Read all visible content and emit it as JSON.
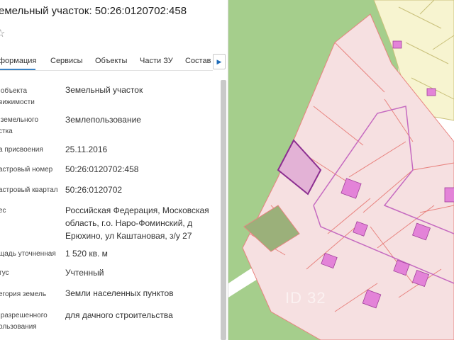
{
  "title": "емельный участок: 50:26:0120702:458",
  "tabs": [
    {
      "label": "формация"
    },
    {
      "label": "Сервисы"
    },
    {
      "label": "Объекты"
    },
    {
      "label": "Части ЗУ"
    },
    {
      "label": "Состав"
    }
  ],
  "fields": [
    {
      "label": " объекта\nвижимости",
      "value": "Земельный участок"
    },
    {
      "label": " земельного\nстка",
      "value": "Землепользование"
    },
    {
      "label": "а присвоения",
      "value": "25.11.2016"
    },
    {
      "label": "астровый номер",
      "value": "50:26:0120702:458"
    },
    {
      "label": "астровый квартал",
      "value": "50:26:0120702"
    },
    {
      "label": "ес",
      "value": "Российская Федерация, Московская область, г.о. Наро-Фоминский, д Ерюхино, ул Каштановая, з/у 27"
    },
    {
      "label": "щадь уточненная",
      "value": "1 520 кв. м"
    },
    {
      "label": "тус",
      "value": "Учтенный"
    },
    {
      "label": "егория земель",
      "value": "Земли населенных пунктов"
    },
    {
      "label": " разрешенного\nользования",
      "value": "для дачного строительства"
    }
  ],
  "icons": {
    "star": "star-icon",
    "tab_scroll": "chevron-right-icon"
  },
  "watermark": "ID 32",
  "colors": {
    "map_green": "#a5ce8c",
    "parcel_fill": "#f6e0e1",
    "parcel_stroke": "#e8837f",
    "selected_fill": "#e3b2d6",
    "selected_stroke": "#8c2e90",
    "building": "#e383d8",
    "yellow_zone": "#f7f4d0",
    "tab_accent": "#3a82c4"
  }
}
